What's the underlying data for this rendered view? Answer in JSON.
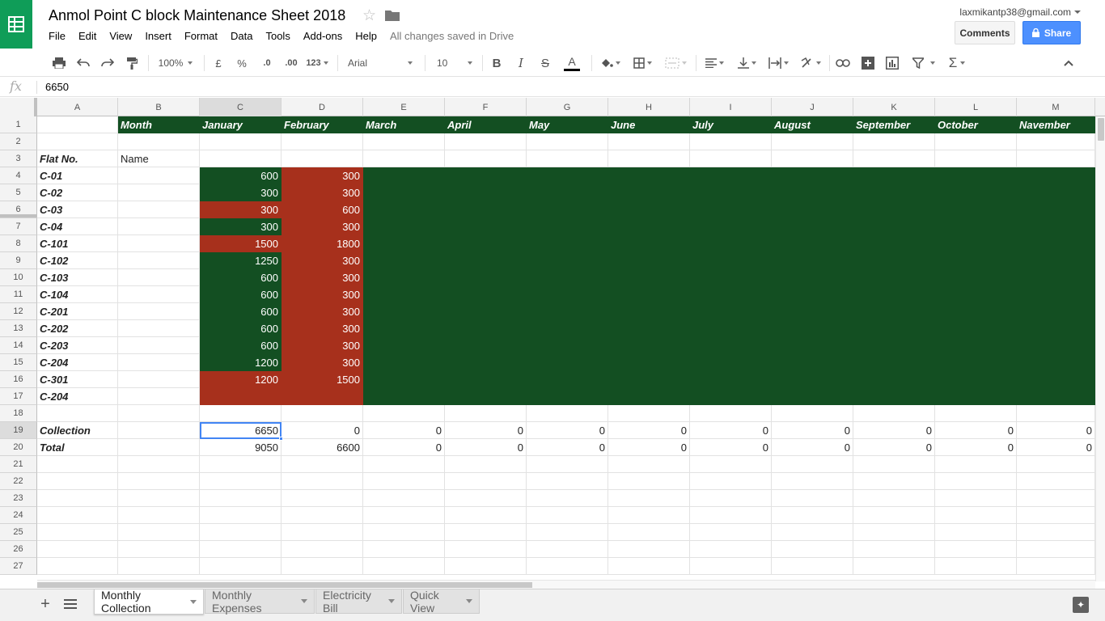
{
  "header": {
    "title": "Anmol Point C block Maintenance Sheet 2018",
    "menus": [
      "File",
      "Edit",
      "View",
      "Insert",
      "Format",
      "Data",
      "Tools",
      "Add-ons",
      "Help"
    ],
    "save_status": "All changes saved in Drive",
    "account": "laxmikantp38@gmail.com",
    "comments_label": "Comments",
    "share_label": "Share"
  },
  "toolbar": {
    "zoom": "100%",
    "currency": "£",
    "percent": "%",
    "decrease_decimals": ".0",
    "increase_decimals": ".00",
    "more_formats": "123",
    "font": "Arial",
    "font_size": "10",
    "bold": "B",
    "italic": "I",
    "strike": "S",
    "text_color_glyph": "A"
  },
  "formula_bar": {
    "value": "6650"
  },
  "columns": [
    "A",
    "B",
    "C",
    "D",
    "E",
    "F",
    "G",
    "H",
    "I",
    "J",
    "K",
    "L",
    "M"
  ],
  "selected_cell": "C19",
  "rows": [
    {
      "n": "1",
      "cells": [
        "",
        "Month",
        "January",
        "February",
        "March",
        "April",
        "May",
        "June",
        "July",
        "August",
        "September",
        "October",
        "Navember"
      ]
    },
    {
      "n": "2",
      "cells": [
        "",
        "",
        "",
        "",
        "",
        "",
        "",
        "",
        "",
        "",
        "",
        "",
        ""
      ]
    },
    {
      "n": "3",
      "cells": [
        "Flat No.",
        "Name",
        "",
        "",
        "",
        "",
        "",
        "",
        "",
        "",
        "",
        "",
        ""
      ]
    },
    {
      "n": "4",
      "cells": [
        "C-01",
        "",
        "600",
        "300",
        "",
        "",
        "",
        "",
        "",
        "",
        "",
        "",
        ""
      ]
    },
    {
      "n": "5",
      "cells": [
        "C-02",
        "",
        "300",
        "300",
        "",
        "",
        "",
        "",
        "",
        "",
        "",
        "",
        ""
      ]
    },
    {
      "n": "6",
      "cells": [
        "C-03",
        "",
        "300",
        "600",
        "",
        "",
        "",
        "",
        "",
        "",
        "",
        "",
        ""
      ]
    },
    {
      "n": "7",
      "cells": [
        "C-04",
        "",
        "300",
        "300",
        "",
        "",
        "",
        "",
        "",
        "",
        "",
        "",
        ""
      ]
    },
    {
      "n": "8",
      "cells": [
        "C-101",
        "",
        "1500",
        "1800",
        "",
        "",
        "",
        "",
        "",
        "",
        "",
        "",
        ""
      ]
    },
    {
      "n": "9",
      "cells": [
        "C-102",
        "",
        "1250",
        "300",
        "",
        "",
        "",
        "",
        "",
        "",
        "",
        "",
        ""
      ]
    },
    {
      "n": "10",
      "cells": [
        "C-103",
        "",
        "600",
        "300",
        "",
        "",
        "",
        "",
        "",
        "",
        "",
        "",
        ""
      ]
    },
    {
      "n": "11",
      "cells": [
        "C-104",
        "",
        "600",
        "300",
        "",
        "",
        "",
        "",
        "",
        "",
        "",
        "",
        ""
      ]
    },
    {
      "n": "12",
      "cells": [
        "C-201",
        "",
        "600",
        "300",
        "",
        "",
        "",
        "",
        "",
        "",
        "",
        "",
        ""
      ]
    },
    {
      "n": "13",
      "cells": [
        "C-202",
        "",
        "600",
        "300",
        "",
        "",
        "",
        "",
        "",
        "",
        "",
        "",
        ""
      ]
    },
    {
      "n": "14",
      "cells": [
        "C-203",
        "",
        "600",
        "300",
        "",
        "",
        "",
        "",
        "",
        "",
        "",
        "",
        ""
      ]
    },
    {
      "n": "15",
      "cells": [
        "C-204",
        "",
        "1200",
        "300",
        "",
        "",
        "",
        "",
        "",
        "",
        "",
        "",
        ""
      ]
    },
    {
      "n": "16",
      "cells": [
        "C-301",
        "",
        "1200",
        "1500",
        "",
        "",
        "",
        "",
        "",
        "",
        "",
        "",
        ""
      ]
    },
    {
      "n": "17",
      "cells": [
        "C-204",
        "",
        "",
        "",
        "",
        "",
        "",
        "",
        "",
        "",
        "",
        "",
        ""
      ]
    },
    {
      "n": "18",
      "cells": [
        "",
        "",
        "",
        "",
        "",
        "",
        "",
        "",
        "",
        "",
        "",
        "",
        ""
      ]
    },
    {
      "n": "19",
      "cells": [
        "Collection",
        "",
        "6650",
        "0",
        "0",
        "0",
        "0",
        "0",
        "0",
        "0",
        "0",
        "0",
        "0"
      ]
    },
    {
      "n": "20",
      "cells": [
        "Total",
        "",
        "9050",
        "6600",
        "0",
        "0",
        "0",
        "0",
        "0",
        "0",
        "0",
        "0",
        "0"
      ]
    },
    {
      "n": "21",
      "cells": [
        "",
        "",
        "",
        "",
        "",
        "",
        "",
        "",
        "",
        "",
        "",
        "",
        ""
      ]
    },
    {
      "n": "22",
      "cells": [
        "",
        "",
        "",
        "",
        "",
        "",
        "",
        "",
        "",
        "",
        "",
        "",
        ""
      ]
    },
    {
      "n": "23",
      "cells": [
        "",
        "",
        "",
        "",
        "",
        "",
        "",
        "",
        "",
        "",
        "",
        "",
        ""
      ]
    },
    {
      "n": "24",
      "cells": [
        "",
        "",
        "",
        "",
        "",
        "",
        "",
        "",
        "",
        "",
        "",
        "",
        ""
      ]
    },
    {
      "n": "25",
      "cells": [
        "",
        "",
        "",
        "",
        "",
        "",
        "",
        "",
        "",
        "",
        "",
        "",
        ""
      ]
    },
    {
      "n": "26",
      "cells": [
        "",
        "",
        "",
        "",
        "",
        "",
        "",
        "",
        "",
        "",
        "",
        "",
        ""
      ]
    },
    {
      "n": "27",
      "cells": [
        "",
        "",
        "",
        "",
        "",
        "",
        "",
        "",
        "",
        "",
        "",
        "",
        ""
      ]
    }
  ],
  "cell_colors": {
    "green": "#134f22",
    "red": "#a7301c",
    "red_cells_C": [
      "6",
      "8",
      "16",
      "17"
    ],
    "red_rows_D": [
      "4",
      "5",
      "6",
      "7",
      "8",
      "9",
      "10",
      "11",
      "12",
      "13",
      "14",
      "15",
      "16",
      "17"
    ]
  },
  "sheet_tabs": [
    {
      "label": "Monthly Collection",
      "active": true
    },
    {
      "label": "Monthly Expenses",
      "active": false
    },
    {
      "label": "Electricity Bill",
      "active": false
    },
    {
      "label": "Quick View",
      "active": false
    }
  ]
}
